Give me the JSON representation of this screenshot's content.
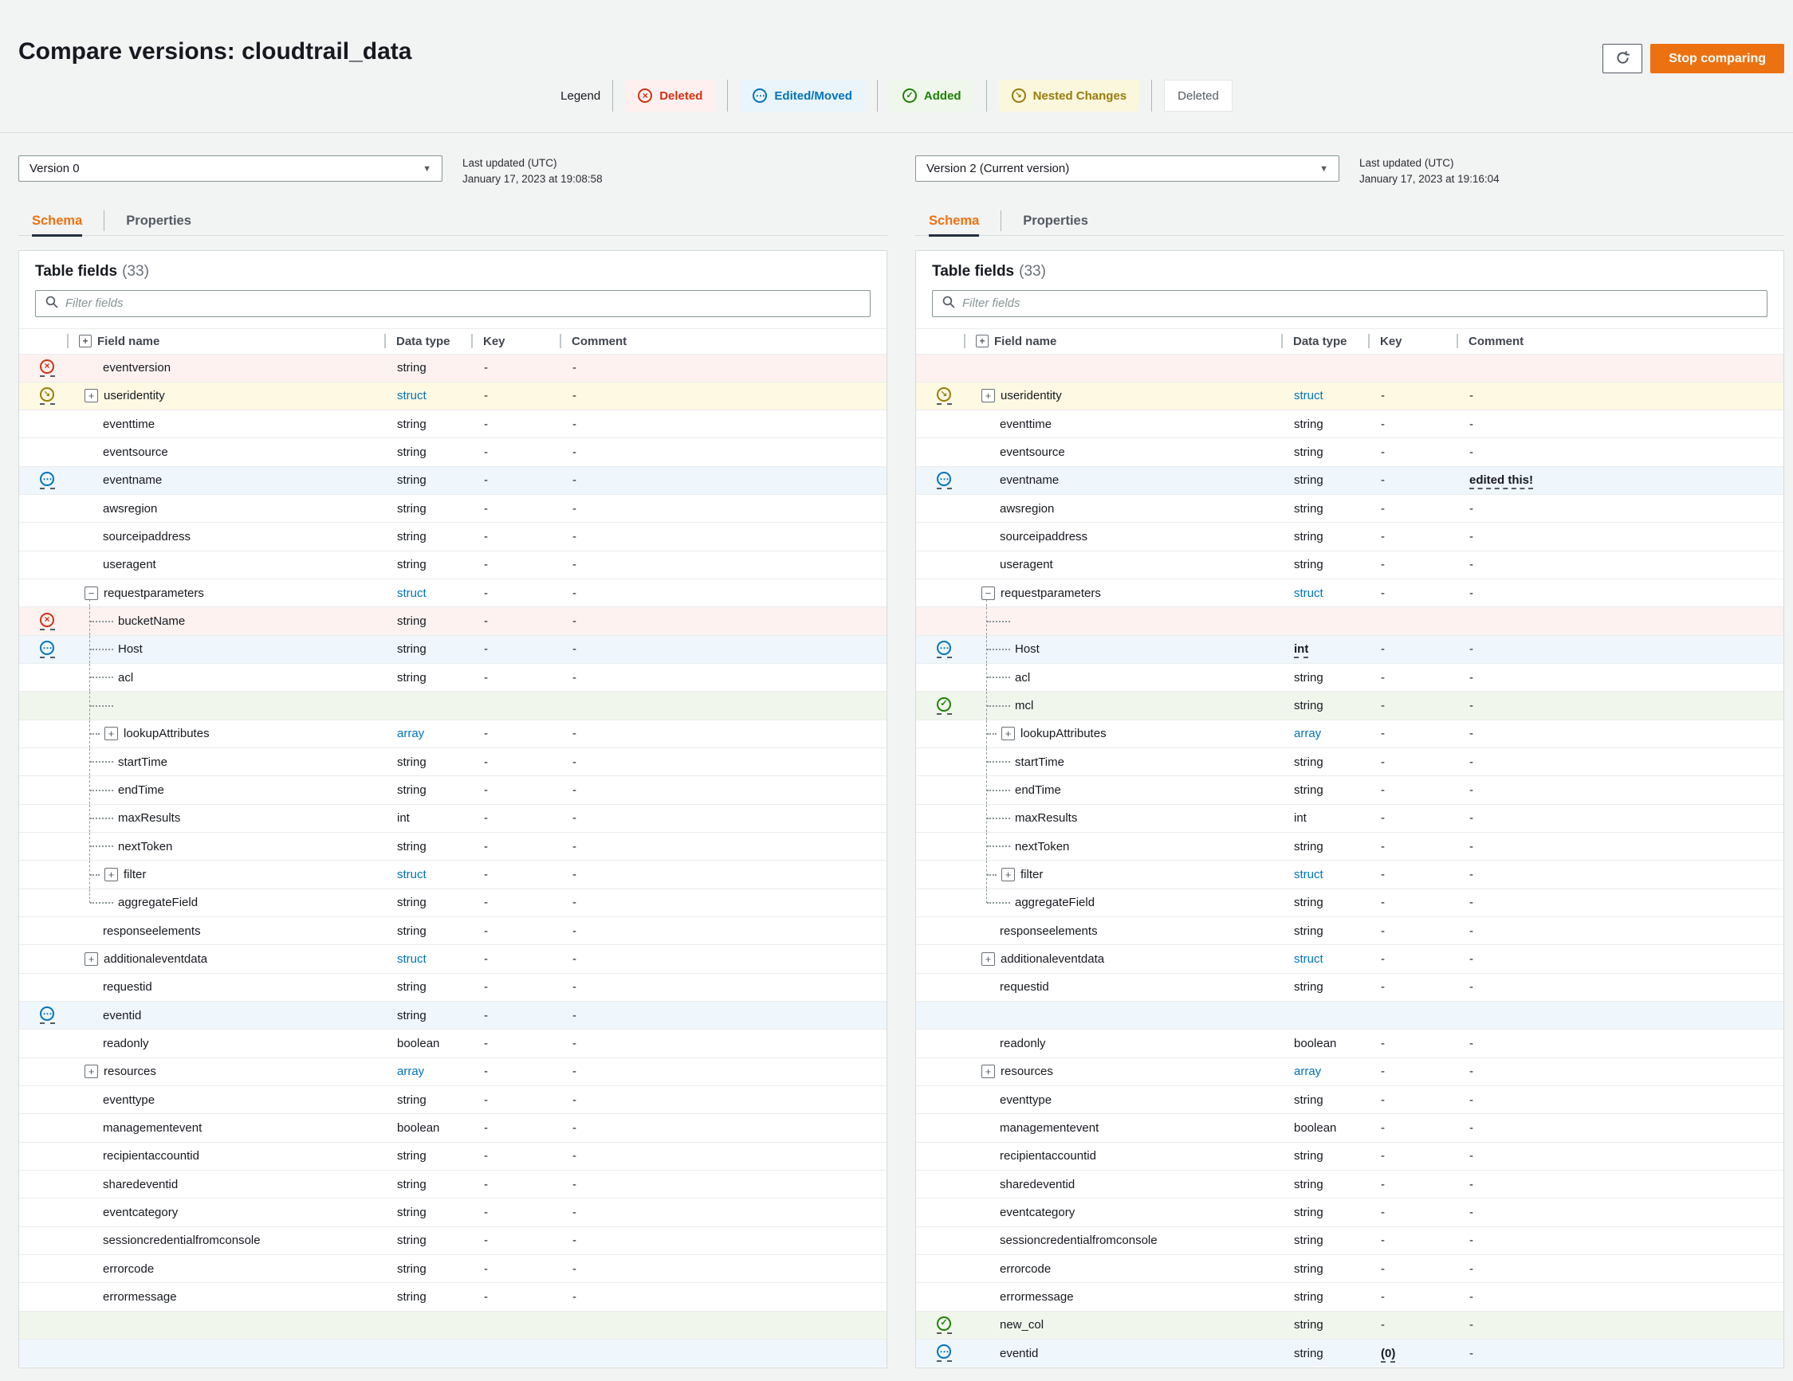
{
  "page": {
    "title": "Compare versions: cloudtrail_data"
  },
  "actions": {
    "stop_comparing": "Stop comparing"
  },
  "icons": {
    "deleted": "×",
    "edited": "⋯",
    "added": "✓",
    "nested": "↘",
    "caret": "▼",
    "plus": "+",
    "minus": "−",
    "header_expand": "+"
  },
  "colors": {
    "accent": "#ec7211",
    "deleted": "#d13212",
    "edited": "#0073bb",
    "added": "#1d8102",
    "nested": "#9a7b0b",
    "link": "#0073bb"
  },
  "legend": {
    "label": "Legend",
    "items": [
      {
        "id": "deleted",
        "label": "Deleted",
        "style": "deleted",
        "icon": "deleted"
      },
      {
        "id": "edited-moved",
        "label": "Edited/Moved",
        "style": "edited",
        "icon": "edited"
      },
      {
        "id": "added",
        "label": "Added",
        "style": "added",
        "icon": "added"
      },
      {
        "id": "nested-changes",
        "label": "Nested Changes",
        "style": "nested",
        "icon": "nested"
      },
      {
        "id": "deleted-plain",
        "label": "Deleted",
        "style": "plain",
        "icon": null
      }
    ]
  },
  "panels": [
    {
      "version_label": "Version 0",
      "last_updated_label": "Last updated (UTC)",
      "last_updated_value": "January 17, 2023 at 19:08:58",
      "tabs": [
        {
          "label": "Schema",
          "active": true
        },
        {
          "label": "Properties",
          "active": false
        }
      ],
      "table_title": "Table fields",
      "table_count": "(33)",
      "filter_placeholder": "Filter fields",
      "columns": [
        "Field name",
        "Data type",
        "Key",
        "Comment"
      ],
      "rows": [
        {
          "status": "deleted",
          "name": "eventversion",
          "type": "string",
          "key": "-",
          "comment": "-"
        },
        {
          "status": "nested",
          "toggle": "plus",
          "name": "useridentity",
          "type": "struct",
          "link": true,
          "key": "-",
          "comment": "-"
        },
        {
          "name": "eventtime",
          "type": "string",
          "key": "-",
          "comment": "-"
        },
        {
          "name": "eventsource",
          "type": "string",
          "key": "-",
          "comment": "-"
        },
        {
          "status": "edited",
          "name": "eventname",
          "type": "string",
          "key": "-",
          "comment": "-"
        },
        {
          "name": "awsregion",
          "type": "string",
          "key": "-",
          "comment": "-"
        },
        {
          "name": "sourceipaddress",
          "type": "string",
          "key": "-",
          "comment": "-"
        },
        {
          "name": "useragent",
          "type": "string",
          "key": "-",
          "comment": "-"
        },
        {
          "toggle": "minus",
          "name": "requestparameters",
          "type": "struct",
          "link": true,
          "key": "-",
          "comment": "-",
          "tree": "parent"
        },
        {
          "status": "deleted",
          "indent": 1,
          "name": "bucketName",
          "type": "string",
          "key": "-",
          "comment": "-",
          "tree": "child"
        },
        {
          "status": "edited",
          "indent": 1,
          "name": "Host",
          "type": "string",
          "key": "-",
          "comment": "-",
          "tree": "child"
        },
        {
          "indent": 1,
          "name": "acl",
          "type": "string",
          "key": "-",
          "comment": "-",
          "tree": "child"
        },
        {
          "empty": true,
          "status": "added",
          "leader": true,
          "tree": "child"
        },
        {
          "indent": 1,
          "toggle": "plus",
          "name": "lookupAttributes",
          "type": "array",
          "link": true,
          "key": "-",
          "comment": "-",
          "tree": "child"
        },
        {
          "indent": 1,
          "name": "startTime",
          "type": "string",
          "key": "-",
          "comment": "-",
          "tree": "child"
        },
        {
          "indent": 1,
          "name": "endTime",
          "type": "string",
          "key": "-",
          "comment": "-",
          "tree": "child"
        },
        {
          "indent": 1,
          "name": "maxResults",
          "type": "int",
          "key": "-",
          "comment": "-",
          "tree": "child"
        },
        {
          "indent": 1,
          "name": "nextToken",
          "type": "string",
          "key": "-",
          "comment": "-",
          "tree": "child"
        },
        {
          "indent": 1,
          "toggle": "plus",
          "name": "filter",
          "type": "struct",
          "link": true,
          "key": "-",
          "comment": "-",
          "tree": "child"
        },
        {
          "indent": 1,
          "name": "aggregateField",
          "type": "string",
          "key": "-",
          "comment": "-",
          "tree": "last"
        },
        {
          "name": "responseelements",
          "type": "string",
          "key": "-",
          "comment": "-"
        },
        {
          "toggle": "plus",
          "name": "additionaleventdata",
          "type": "struct",
          "link": true,
          "key": "-",
          "comment": "-"
        },
        {
          "name": "requestid",
          "type": "string",
          "key": "-",
          "comment": "-"
        },
        {
          "status": "edited",
          "name": "eventid",
          "type": "string",
          "key": "-",
          "comment": "-"
        },
        {
          "name": "readonly",
          "type": "boolean",
          "key": "-",
          "comment": "-"
        },
        {
          "toggle": "plus",
          "name": "resources",
          "type": "array",
          "link": true,
          "key": "-",
          "comment": "-"
        },
        {
          "name": "eventtype",
          "type": "string",
          "key": "-",
          "comment": "-"
        },
        {
          "name": "managementevent",
          "type": "boolean",
          "key": "-",
          "comment": "-"
        },
        {
          "name": "recipientaccountid",
          "type": "string",
          "key": "-",
          "comment": "-"
        },
        {
          "name": "sharedeventid",
          "type": "string",
          "key": "-",
          "comment": "-"
        },
        {
          "name": "eventcategory",
          "type": "string",
          "key": "-",
          "comment": "-"
        },
        {
          "name": "sessioncredentialfromconsole",
          "type": "string",
          "key": "-",
          "comment": "-"
        },
        {
          "name": "errorcode",
          "type": "string",
          "key": "-",
          "comment": "-"
        },
        {
          "name": "errormessage",
          "type": "string",
          "key": "-",
          "comment": "-"
        },
        {
          "empty": true,
          "status": "added"
        },
        {
          "empty": true,
          "status": "edited"
        }
      ]
    },
    {
      "version_label": "Version 2 (Current version)",
      "last_updated_label": "Last updated (UTC)",
      "last_updated_value": "January 17, 2023 at 19:16:04",
      "tabs": [
        {
          "label": "Schema",
          "active": true
        },
        {
          "label": "Properties",
          "active": false
        }
      ],
      "table_title": "Table fields",
      "table_count": "(33)",
      "filter_placeholder": "Filter fields",
      "columns": [
        "Field name",
        "Data type",
        "Key",
        "Comment"
      ],
      "rows": [
        {
          "empty": true,
          "status": "deleted"
        },
        {
          "status": "nested",
          "toggle": "plus",
          "name": "useridentity",
          "type": "struct",
          "link": true,
          "key": "-",
          "comment": "-"
        },
        {
          "name": "eventtime",
          "type": "string",
          "key": "-",
          "comment": "-"
        },
        {
          "name": "eventsource",
          "type": "string",
          "key": "-",
          "comment": "-"
        },
        {
          "status": "edited",
          "name": "eventname",
          "type": "string",
          "key": "-",
          "comment": "edited this!",
          "emph": "comment"
        },
        {
          "name": "awsregion",
          "type": "string",
          "key": "-",
          "comment": "-"
        },
        {
          "name": "sourceipaddress",
          "type": "string",
          "key": "-",
          "comment": "-"
        },
        {
          "name": "useragent",
          "type": "string",
          "key": "-",
          "comment": "-"
        },
        {
          "toggle": "minus",
          "name": "requestparameters",
          "type": "struct",
          "link": true,
          "key": "-",
          "comment": "-",
          "tree": "parent"
        },
        {
          "empty": true,
          "status": "deleted",
          "leader": true,
          "tree": "child"
        },
        {
          "status": "edited",
          "indent": 1,
          "name": "Host",
          "type": "int",
          "emph": "type",
          "key": "-",
          "comment": "-",
          "tree": "child"
        },
        {
          "indent": 1,
          "name": "acl",
          "type": "string",
          "key": "-",
          "comment": "-",
          "tree": "child"
        },
        {
          "status": "added",
          "indent": 1,
          "name": "mcl",
          "type": "string",
          "key": "-",
          "comment": "-",
          "tree": "child"
        },
        {
          "indent": 1,
          "toggle": "plus",
          "name": "lookupAttributes",
          "type": "array",
          "link": true,
          "key": "-",
          "comment": "-",
          "tree": "child"
        },
        {
          "indent": 1,
          "name": "startTime",
          "type": "string",
          "key": "-",
          "comment": "-",
          "tree": "child"
        },
        {
          "indent": 1,
          "name": "endTime",
          "type": "string",
          "key": "-",
          "comment": "-",
          "tree": "child"
        },
        {
          "indent": 1,
          "name": "maxResults",
          "type": "int",
          "key": "-",
          "comment": "-",
          "tree": "child"
        },
        {
          "indent": 1,
          "name": "nextToken",
          "type": "string",
          "key": "-",
          "comment": "-",
          "tree": "child"
        },
        {
          "indent": 1,
          "toggle": "plus",
          "name": "filter",
          "type": "struct",
          "link": true,
          "key": "-",
          "comment": "-",
          "tree": "child"
        },
        {
          "indent": 1,
          "name": "aggregateField",
          "type": "string",
          "key": "-",
          "comment": "-",
          "tree": "last"
        },
        {
          "name": "responseelements",
          "type": "string",
          "key": "-",
          "comment": "-"
        },
        {
          "toggle": "plus",
          "name": "additionaleventdata",
          "type": "struct",
          "link": true,
          "key": "-",
          "comment": "-"
        },
        {
          "name": "requestid",
          "type": "string",
          "key": "-",
          "comment": "-"
        },
        {
          "empty": true,
          "status": "edited"
        },
        {
          "name": "readonly",
          "type": "boolean",
          "key": "-",
          "comment": "-"
        },
        {
          "toggle": "plus",
          "name": "resources",
          "type": "array",
          "link": true,
          "key": "-",
          "comment": "-"
        },
        {
          "name": "eventtype",
          "type": "string",
          "key": "-",
          "comment": "-"
        },
        {
          "name": "managementevent",
          "type": "boolean",
          "key": "-",
          "comment": "-"
        },
        {
          "name": "recipientaccountid",
          "type": "string",
          "key": "-",
          "comment": "-"
        },
        {
          "name": "sharedeventid",
          "type": "string",
          "key": "-",
          "comment": "-"
        },
        {
          "name": "eventcategory",
          "type": "string",
          "key": "-",
          "comment": "-"
        },
        {
          "name": "sessioncredentialfromconsole",
          "type": "string",
          "key": "-",
          "comment": "-"
        },
        {
          "name": "errorcode",
          "type": "string",
          "key": "-",
          "comment": "-"
        },
        {
          "name": "errormessage",
          "type": "string",
          "key": "-",
          "comment": "-"
        },
        {
          "status": "added",
          "name": "new_col",
          "type": "string",
          "key": "-",
          "comment": "-"
        },
        {
          "status": "edited",
          "name": "eventid",
          "type": "string",
          "key": "(0)",
          "emph": "key",
          "comment": "-"
        }
      ]
    }
  ]
}
